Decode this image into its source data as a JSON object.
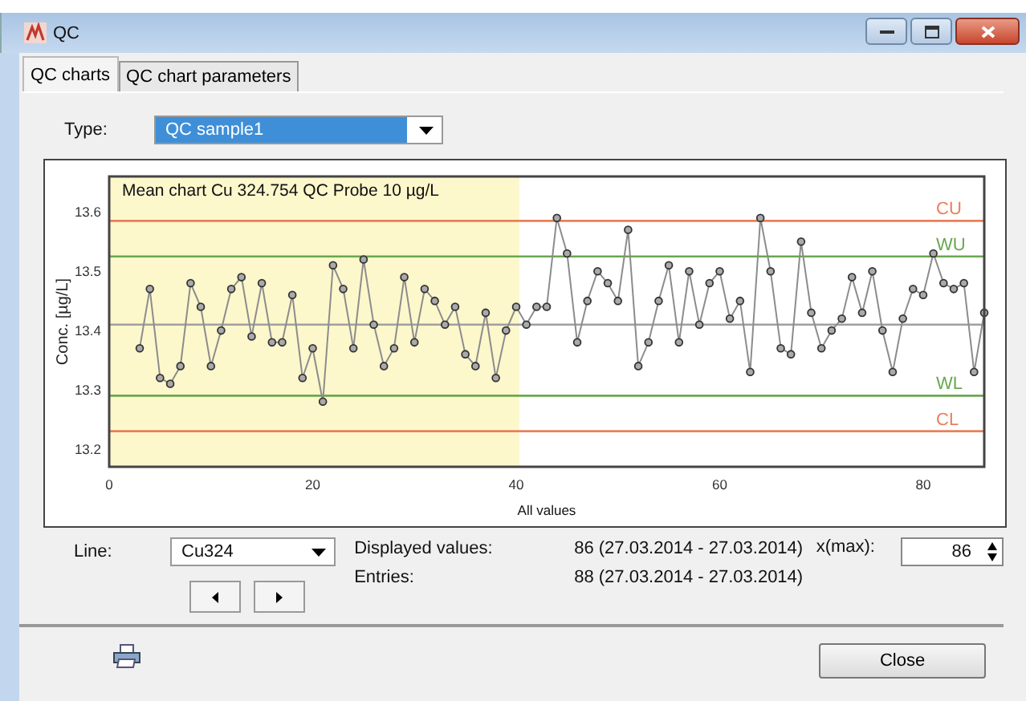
{
  "window": {
    "title": "QC"
  },
  "tabs": [
    {
      "label": "QC charts",
      "selected": true
    },
    {
      "label": "QC chart parameters",
      "selected": false
    }
  ],
  "type_field": {
    "label": "Type:",
    "value": "QC sample1"
  },
  "chart": {
    "chart_data": {
      "type": "line",
      "title": "Mean chart Cu 324.754 QC Probe 10 µg/L",
      "xlabel": "All values",
      "ylabel": "Conc. [µg/L]",
      "x": [
        3,
        4,
        5,
        6,
        7,
        8,
        9,
        10,
        11,
        12,
        13,
        14,
        15,
        16,
        17,
        18,
        19,
        20,
        21,
        22,
        23,
        24,
        25,
        26,
        27,
        28,
        29,
        30,
        31,
        32,
        33,
        34,
        35,
        36,
        37,
        38,
        39,
        40,
        41,
        42,
        43,
        44,
        45,
        46,
        47,
        48,
        49,
        50,
        51,
        52,
        53,
        54,
        55,
        56,
        57,
        58,
        59,
        60,
        61,
        62,
        63,
        64,
        65,
        66,
        67,
        68,
        69,
        70,
        71,
        72,
        73,
        74,
        75,
        76,
        77,
        78,
        79,
        80,
        81,
        82,
        83,
        84,
        85,
        86
      ],
      "series": [
        {
          "color": "#8c8c8c",
          "marker": "circle",
          "values": [
            13.37,
            13.47,
            13.32,
            13.31,
            13.34,
            13.48,
            13.44,
            13.34,
            13.4,
            13.47,
            13.49,
            13.39,
            13.48,
            13.38,
            13.38,
            13.46,
            13.32,
            13.37,
            13.28,
            13.51,
            13.47,
            13.37,
            13.52,
            13.41,
            13.34,
            13.37,
            13.49,
            13.38,
            13.47,
            13.45,
            13.41,
            13.44,
            13.36,
            13.34,
            13.43,
            13.32,
            13.4,
            13.44,
            13.41,
            13.44,
            13.44,
            13.59,
            13.53,
            13.38,
            13.45,
            13.5,
            13.48,
            13.45,
            13.57,
            13.34,
            13.38,
            13.45,
            13.51,
            13.38,
            13.5,
            13.41,
            13.48,
            13.5,
            13.42,
            13.45,
            13.33,
            13.59,
            13.5,
            13.37,
            13.36,
            13.55,
            13.43,
            13.37,
            13.4,
            13.42,
            13.49,
            13.43,
            13.5,
            13.4,
            13.33,
            13.42,
            13.47,
            13.46,
            13.53,
            13.48,
            13.47,
            13.48,
            13.33,
            13.43
          ]
        }
      ],
      "xlim": [
        0,
        86
      ],
      "ylim": [
        13.17,
        13.66
      ],
      "xticks": [
        0,
        20,
        40,
        60,
        80
      ],
      "yticks": [
        {
          "value": 13.2,
          "label": "13.2"
        },
        {
          "value": 13.3,
          "label": "13.3"
        },
        {
          "value": 13.4,
          "label": "13.4"
        },
        {
          "value": 13.5,
          "label": "13.5"
        },
        {
          "value": 13.6,
          "label": "13.6"
        }
      ],
      "bands": [
        {
          "axis": "x",
          "from": 0,
          "to": 40.3,
          "color": "#fdf7cc"
        }
      ],
      "ref_lines": [
        {
          "axis": "y",
          "value": 13.585,
          "label": "CU",
          "color": "#e8805a"
        },
        {
          "axis": "y",
          "value": 13.525,
          "label": "WU",
          "color": "#6aa84f"
        },
        {
          "axis": "y",
          "value": 13.41,
          "color": "#a0a0a0"
        },
        {
          "axis": "y",
          "value": 13.29,
          "label": "WL",
          "color": "#6aa84f"
        },
        {
          "axis": "y",
          "value": 13.23,
          "label": "CL",
          "color": "#e8805a"
        }
      ]
    }
  },
  "line_field": {
    "label": "Line:",
    "value": "Cu324"
  },
  "info": [
    {
      "label": "Displayed values:",
      "value": "86 (27.03.2014 - 27.03.2014)"
    },
    {
      "label": "Entries:",
      "value": "88 (27.03.2014 - 27.03.2014)"
    }
  ],
  "xmax_field": {
    "label": "x(max):",
    "value": "86"
  },
  "buttons": [
    "Close"
  ]
}
